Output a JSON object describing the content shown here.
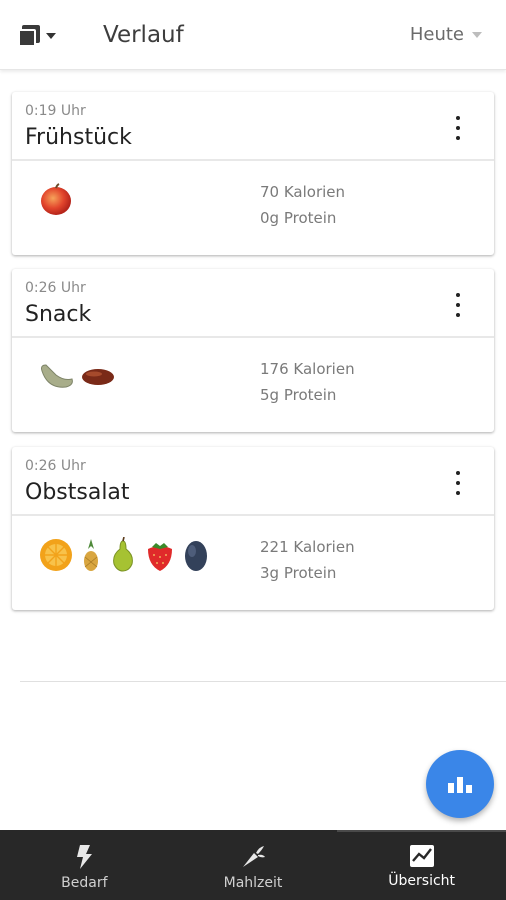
{
  "header": {
    "title": "Verlauf",
    "period_label": "Heute",
    "menu_icon": "stack-icon"
  },
  "meals": [
    {
      "time": "0:19 Uhr",
      "name": "Frühstück",
      "calories": "70 Kalorien",
      "protein": "0g Protein",
      "foods": [
        "apple"
      ]
    },
    {
      "time": "0:26 Uhr",
      "name": "Snack",
      "calories": "176 Kalorien",
      "protein": "5g Protein",
      "foods": [
        "cashew",
        "date"
      ]
    },
    {
      "time": "0:26 Uhr",
      "name": "Obstsalat",
      "calories": "221 Kalorien",
      "protein": "3g Protein",
      "foods": [
        "orange",
        "pineapple",
        "pear",
        "strawberry",
        "plum"
      ]
    }
  ],
  "fab": {
    "icon": "bar-chart-icon"
  },
  "bottom_nav": [
    {
      "label": "Bedarf",
      "icon": "lightning-icon",
      "active": false
    },
    {
      "label": "Mahlzeit",
      "icon": "carrot-icon",
      "active": false
    },
    {
      "label": "Übersicht",
      "icon": "trend-chart-icon",
      "active": true
    }
  ],
  "colors": {
    "accent": "#3a86e8",
    "nav_background": "#282828"
  }
}
